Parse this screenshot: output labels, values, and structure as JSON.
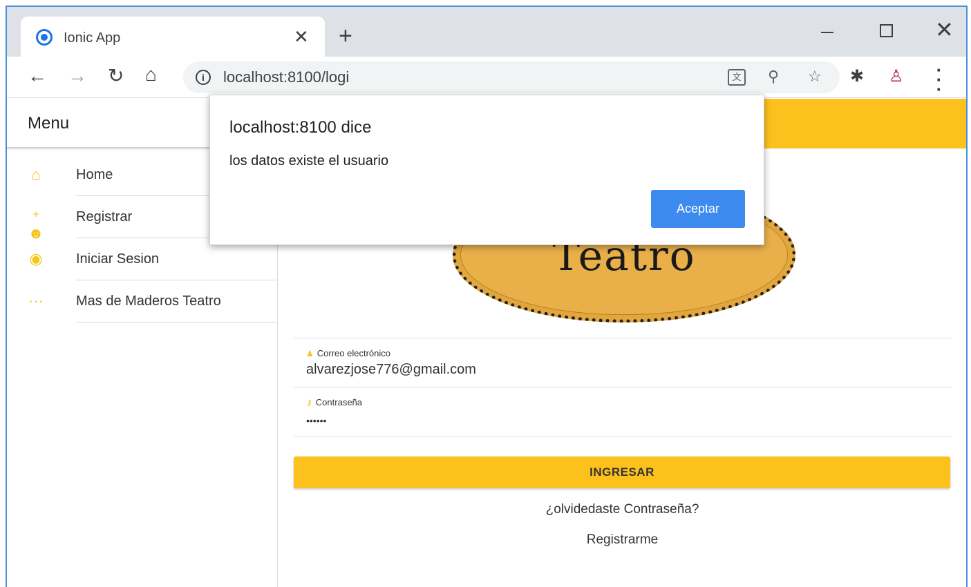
{
  "browser": {
    "tab_title": "Ionic App",
    "tab_close": "✕",
    "new_tab": "+",
    "url": "localhost:8100/logi",
    "window_close": "✕"
  },
  "menu": {
    "title": "Menu",
    "items": [
      {
        "label": "Home",
        "icon": "home-icon"
      },
      {
        "label": "Registrar",
        "icon": "person-add-icon"
      },
      {
        "label": "Iniciar Sesion",
        "icon": "login-icon"
      },
      {
        "label": "Mas de Maderos Teatro",
        "icon": "ellipsis-icon"
      }
    ]
  },
  "logo": {
    "text": "Teatro"
  },
  "form": {
    "email_label": "Correo electrónico",
    "email_value": "alvarezjose776@gmail.com",
    "password_label": "Contraseña",
    "password_value": "••••••",
    "submit_label": "INGRESAR",
    "forgot_link": "¿olvidedaste Contraseña?",
    "register_link": "Registrarme"
  },
  "alert": {
    "title": "localhost:8100 dice",
    "message": "los datos  existe el usuario",
    "accept_label": "Aceptar"
  },
  "colors": {
    "accent": "#fdc11d",
    "dialog_button": "#3d8bef"
  }
}
